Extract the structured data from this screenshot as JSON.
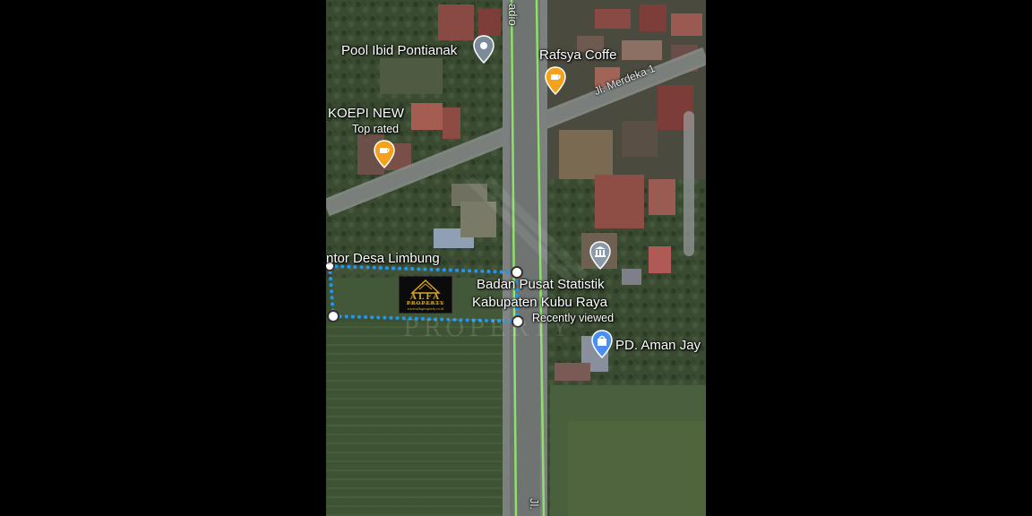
{
  "map": {
    "place_labels": {
      "pool_ibid": "Pool Ibid Pontianak",
      "rafsya": "Rafsya Coffe",
      "koepi": "KOEPI NEW",
      "koepi_sub": "Top rated",
      "kantor_desa": "ntor Desa Limbung",
      "bps_line1": "Badan Pusat Statistik",
      "bps_line2": "Kabupaten Kubu Raya",
      "bps_sub": "Recently viewed",
      "aman_jaya": "PD. Aman Jay"
    },
    "street_labels": {
      "top_road": "adio",
      "merdeka": "Jl. Merdeka 1",
      "bottom_road": "Jl."
    },
    "logo": {
      "name": "ALFA",
      "tagline": "PROPERTY",
      "url": "www.alfaproperty.co.id"
    },
    "watermark": "PROPERTY",
    "colors": {
      "pin_cafe": "#f4a21b",
      "pin_gray": "#7b8b99",
      "pin_blue": "#4c8ef3",
      "pin_museum": "#8a9aa8",
      "measure_line": "#2196f3",
      "route_line": "#8fe06a"
    },
    "icons": [
      "cafe-icon",
      "map-pin-icon",
      "museum-icon",
      "shopping-bag-icon"
    ]
  }
}
